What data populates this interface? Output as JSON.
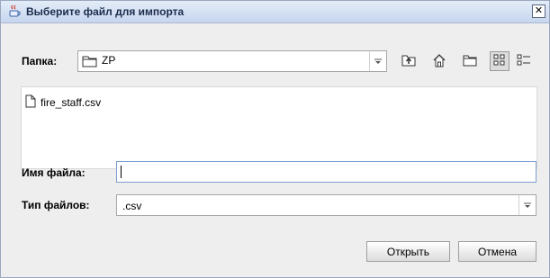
{
  "window": {
    "title": "Выберите файл для импорта",
    "icon": "java-cup-icon",
    "close_glyph": "✕"
  },
  "look_in": {
    "label": "Папка:",
    "value": "ZP",
    "icon": "folder-icon"
  },
  "toolbar": {
    "buttons": [
      {
        "name": "up-one-level-icon"
      },
      {
        "name": "home-icon"
      },
      {
        "name": "new-folder-icon"
      },
      {
        "name": "list-view-icon",
        "active": true
      },
      {
        "name": "details-view-icon"
      }
    ]
  },
  "files": [
    {
      "name": "fire_staff.csv",
      "icon": "file-icon"
    }
  ],
  "filename": {
    "label": "Имя файла:",
    "value": ""
  },
  "filetype": {
    "label": "Тип файлов:",
    "value": ".csv"
  },
  "buttons": {
    "open": "Открыть",
    "cancel": "Отмена"
  },
  "colors": {
    "titlebar": "#c7d6ee",
    "background": "#eeeeee",
    "focus_border": "#7c9ed1"
  }
}
